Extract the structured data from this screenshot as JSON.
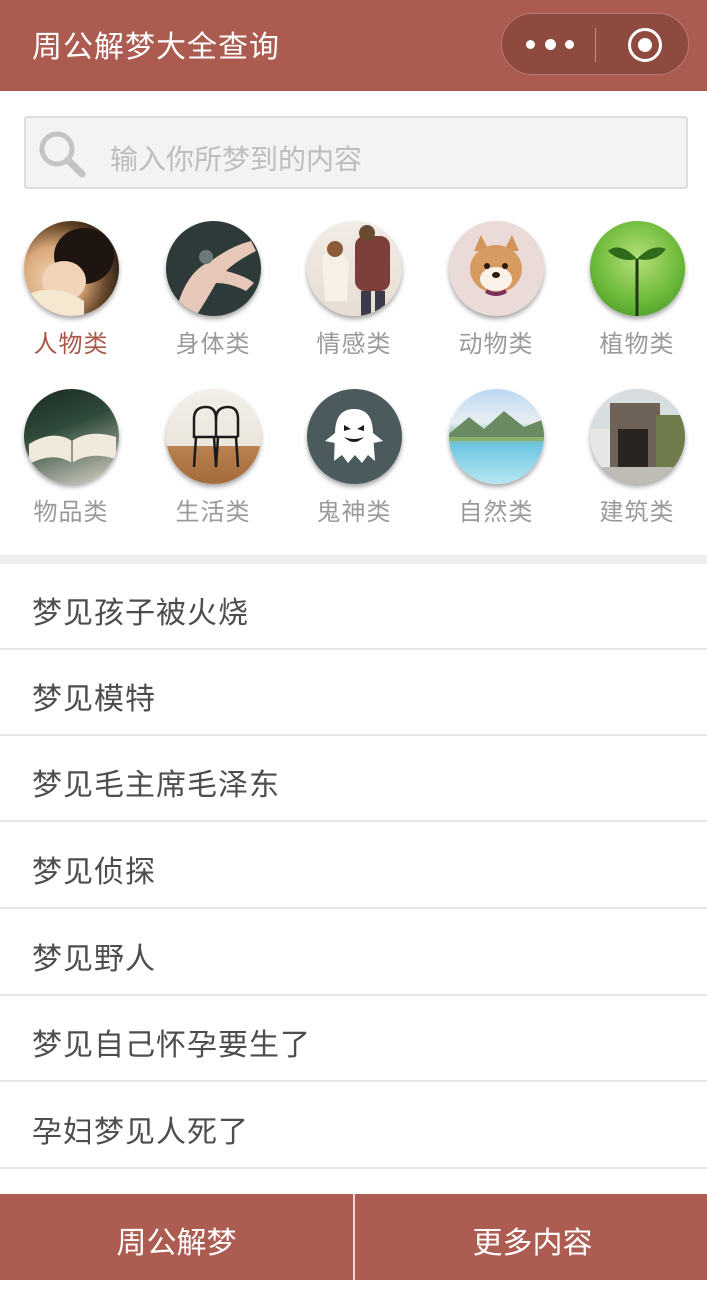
{
  "header": {
    "title": "周公解梦大全查询",
    "accent": "#ab5b4f"
  },
  "capsule": {
    "more_icon": "more-dots-icon",
    "close_icon": "target-circle-icon"
  },
  "search": {
    "placeholder": "输入你所梦到的内容",
    "icon": "search-icon"
  },
  "categories": [
    {
      "label": "人物类",
      "active": true
    },
    {
      "label": "身体类",
      "active": false
    },
    {
      "label": "情感类",
      "active": false
    },
    {
      "label": "动物类",
      "active": false
    },
    {
      "label": "植物类",
      "active": false
    },
    {
      "label": "物品类",
      "active": false
    },
    {
      "label": "生活类",
      "active": false
    },
    {
      "label": "鬼神类",
      "active": false
    },
    {
      "label": "自然类",
      "active": false
    },
    {
      "label": "建筑类",
      "active": false
    }
  ],
  "dreams": [
    "梦见孩子被火烧",
    "梦见模特",
    "梦见毛主席毛泽东",
    "梦见侦探",
    "梦见野人",
    "梦见自己怀孕要生了",
    "孕妇梦见人死了"
  ],
  "bottom_bar": {
    "left": "周公解梦",
    "right": "更多内容"
  }
}
